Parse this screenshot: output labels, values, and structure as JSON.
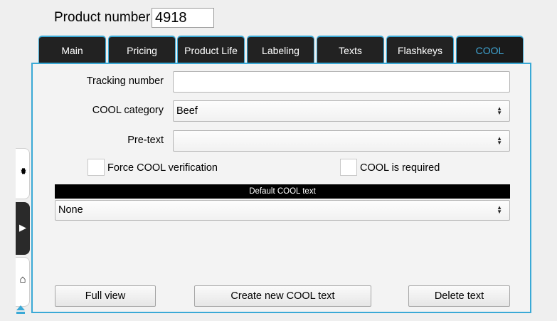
{
  "header": {
    "product_number_label": "Product number",
    "product_number_value": "4918"
  },
  "tabs": [
    {
      "label": "Main",
      "active": false
    },
    {
      "label": "Pricing",
      "active": false
    },
    {
      "label": "Product Life",
      "active": false
    },
    {
      "label": "Labeling",
      "active": false
    },
    {
      "label": "Texts",
      "active": false
    },
    {
      "label": "Flashkeys",
      "active": false
    },
    {
      "label": "COOL",
      "active": true
    }
  ],
  "form": {
    "tracking_number_label": "Tracking number",
    "tracking_number_value": "",
    "cool_category_label": "COOL category",
    "cool_category_value": "Beef",
    "pre_text_label": "Pre-text",
    "pre_text_value": "",
    "force_verification_label": "Force COOL verification",
    "force_verification_checked": false,
    "cool_required_label": "COOL is required",
    "cool_required_checked": false,
    "default_cool_text_header": "Default COOL text",
    "default_cool_text_value": "None"
  },
  "buttons": {
    "full_view": "Full view",
    "create_new": "Create new COOL text",
    "delete_text": "Delete text"
  },
  "colors": {
    "accent": "#3aa9d6",
    "tab_bg": "#222222",
    "active_tab_text": "#41a7d6"
  },
  "icons": {
    "select_arrows": "up-down-arrows-icon",
    "dock_collapse": "collapse-arrows-icon",
    "dock_expand": "play-arrow-icon",
    "dock_home": "home-icon",
    "dock_eject": "eject-icon"
  }
}
